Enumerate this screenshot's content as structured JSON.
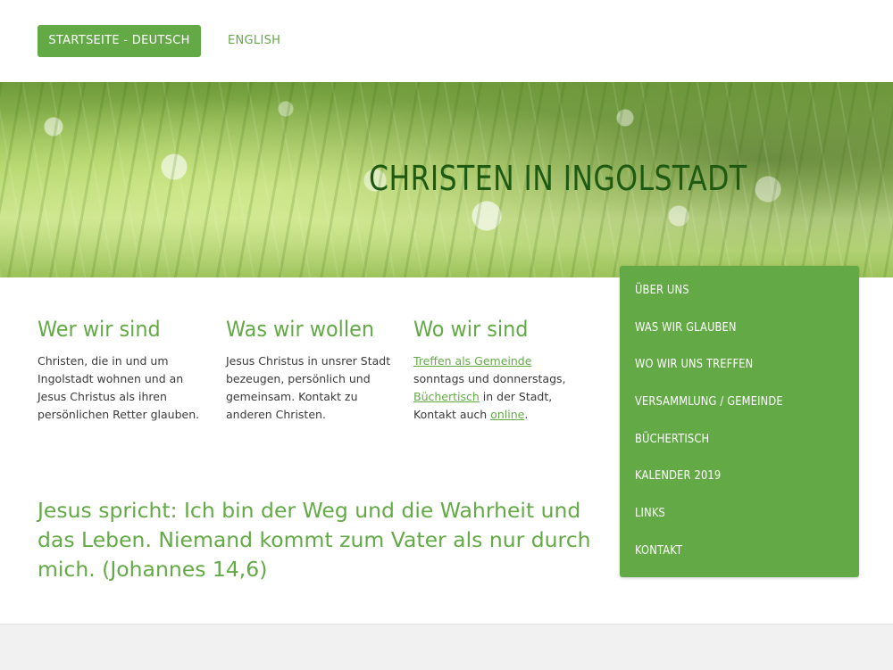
{
  "header": {
    "lang_active": "STARTSEITE - DEUTSCH",
    "lang_other": "ENGLISH"
  },
  "hero": {
    "title": "CHRISTEN IN INGOLSTADT"
  },
  "menu": {
    "items": [
      "ÜBER UNS",
      "WAS WIR GLAUBEN",
      "WO WIR UNS TREFFEN",
      "VERSAMMLUNG / GEMEINDE",
      "BÜCHERTISCH",
      "KALENDER 2019",
      "LINKS",
      "KONTAKT"
    ]
  },
  "columns": [
    {
      "heading": "Wer wir sind",
      "text": "Christen, die in und um Ingolstadt wohnen und an Jesus Christus als ihren persönlichen Retter glauben."
    },
    {
      "heading": "Was wir wollen",
      "text": "Jesus Christus in unsrer Stadt bezeugen, persönlich und gemeinsam. Kontakt zu anderen Christen."
    },
    {
      "heading": "Wo wir sind",
      "link1": "Treffen als Gemeinde",
      "text1": " sonntags und donnerstags, ",
      "link2": "Büchertisch",
      "text2": " in der Stadt, Kontakt auch ",
      "link3": "online",
      "text3": "."
    }
  ],
  "quote": "Jesus spricht: Ich bin der Weg und die Wahrheit und das Leben. Niemand kommt zum Vater als nur durch mich.   (Johannes 14,6)",
  "colors": {
    "accent": "#63aa47",
    "hero_title": "#1f5a13",
    "footer": "#f1f1f1"
  }
}
